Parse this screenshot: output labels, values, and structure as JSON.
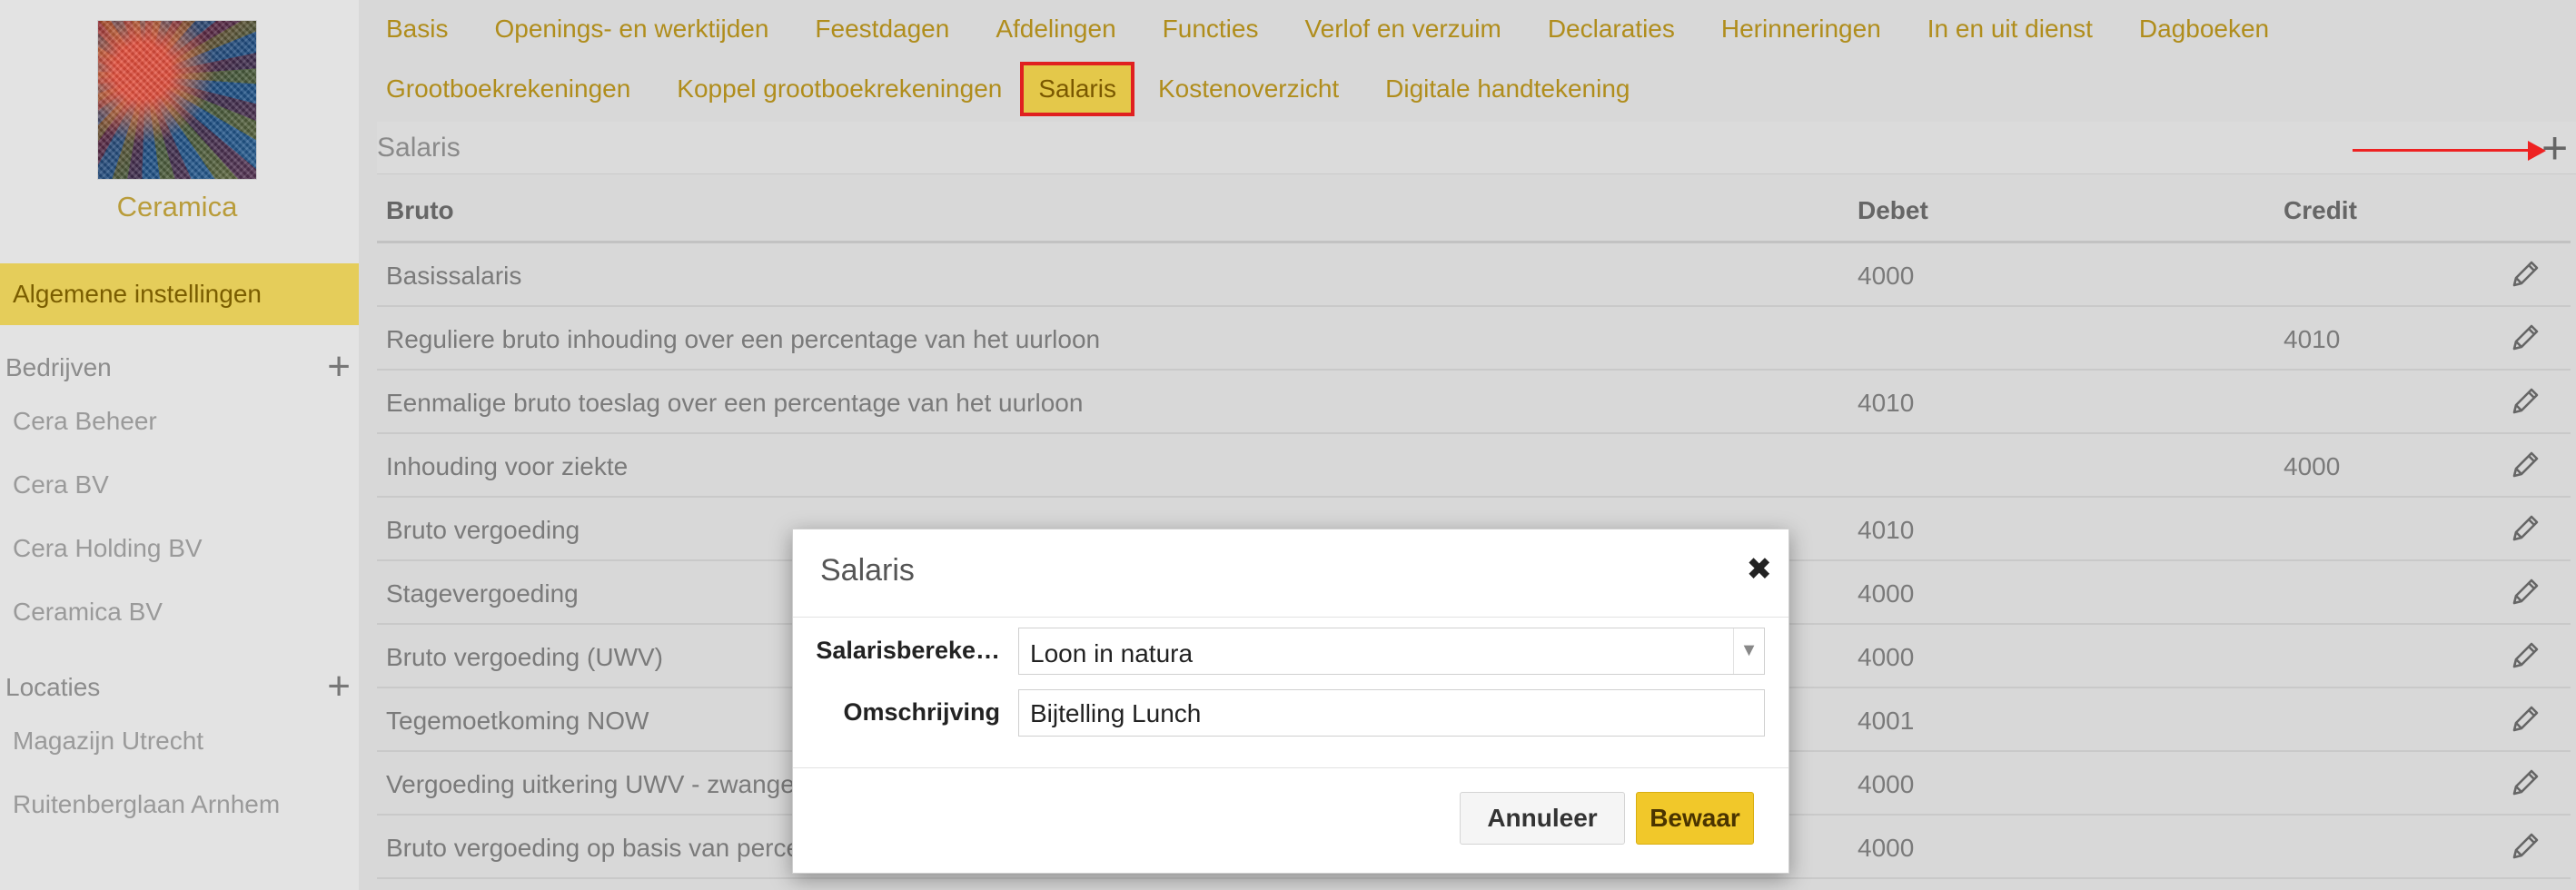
{
  "company": {
    "name": "Ceramica"
  },
  "sidebar": {
    "active_item": "Algemene instellingen",
    "sections": [
      {
        "title": "Bedrijven",
        "items": [
          "Cera Beheer",
          "Cera BV",
          "Cera Holding BV",
          "Ceramica BV"
        ]
      },
      {
        "title": "Locaties",
        "items": [
          "Magazijn Utrecht",
          "Ruitenberglaan Arnhem"
        ]
      }
    ]
  },
  "nav": {
    "row1": [
      "Basis",
      "Openings- en werktijden",
      "Feestdagen",
      "Afdelingen",
      "Functies",
      "Verlof en verzuim",
      "Declaraties",
      "Herinneringen",
      "In en uit dienst",
      "Dagboeken"
    ],
    "row2": [
      "Grootboekrekeningen",
      "Koppel grootboekrekeningen",
      "Salaris",
      "Kostenoverzicht",
      "Digitale handtekening"
    ],
    "active": "Salaris"
  },
  "panel": {
    "title": "Salaris",
    "add_icon": "plus-icon"
  },
  "table": {
    "headers": {
      "bruto": "Bruto",
      "debet": "Debet",
      "credit": "Credit"
    },
    "rows": [
      {
        "bruto": "Basissalaris",
        "debet": "4000",
        "credit": ""
      },
      {
        "bruto": "Reguliere bruto inhouding over een percentage van het uurloon",
        "debet": "",
        "credit": "4010"
      },
      {
        "bruto": "Eenmalige bruto toeslag over een percentage van het uurloon",
        "debet": "4010",
        "credit": ""
      },
      {
        "bruto": "Inhouding voor ziekte",
        "debet": "",
        "credit": "4000"
      },
      {
        "bruto": "Bruto vergoeding",
        "debet": "4010",
        "credit": ""
      },
      {
        "bruto": "Stagevergoeding",
        "debet": "4000",
        "credit": ""
      },
      {
        "bruto": "Bruto vergoeding (UWV)",
        "debet": "4000",
        "credit": ""
      },
      {
        "bruto": "Tegemoetkoming NOW",
        "debet": "4001",
        "credit": ""
      },
      {
        "bruto": "Vergoeding uitkering UWV - zwangerschap",
        "debet": "4000",
        "credit": ""
      },
      {
        "bruto": "Bruto vergoeding op basis van percentage",
        "debet": "4000",
        "credit": ""
      }
    ]
  },
  "modal": {
    "title": "Salaris",
    "label_calc": "Salarisbereke…",
    "calc_value": "Loon in natura",
    "label_desc": "Omschrijving",
    "desc_value": "Bijtelling Lunch",
    "cancel_label": "Annuleer",
    "save_label": "Bewaar"
  }
}
